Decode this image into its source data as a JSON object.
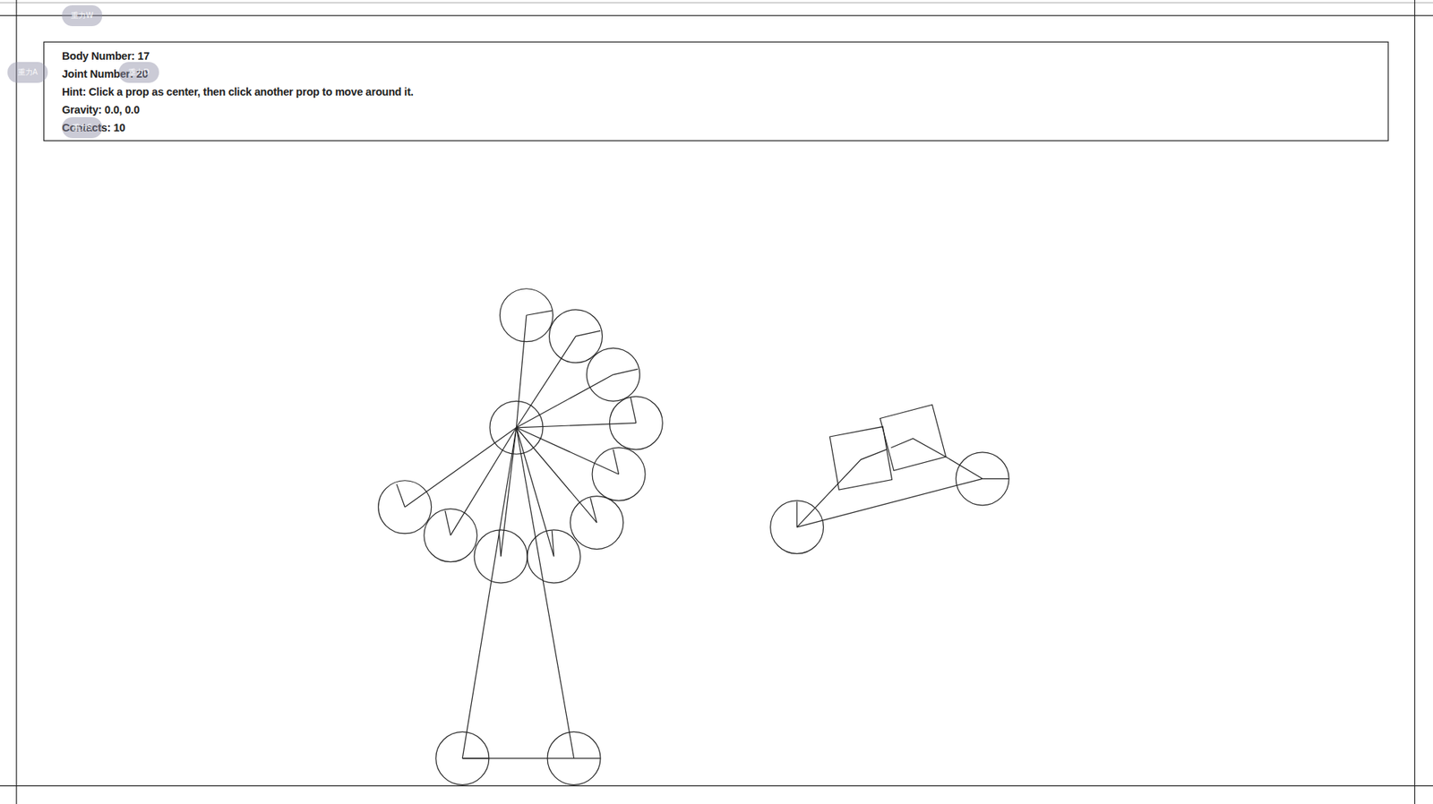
{
  "info": {
    "lines": [
      "Body Number: 17",
      "Joint Number: 20",
      "Hint: Click a prop as center, then click another prop to move around it.",
      "Gravity: 0.0, 0.0",
      "Contacts: 10"
    ]
  },
  "gravity_buttons": [
    {
      "label": "重力W"
    },
    {
      "label": "重力A"
    },
    {
      "label": "重力D"
    },
    {
      "label": "重力S"
    }
  ]
}
